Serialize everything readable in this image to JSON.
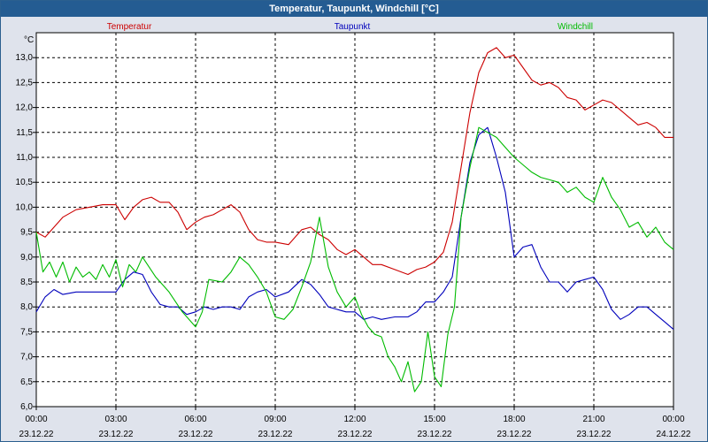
{
  "window": {
    "title": "Temperatur, Taupunkt, Windchill [°C]"
  },
  "colors": {
    "temperature": "#cc0000",
    "dewpoint": "#0000bb",
    "windchill": "#00bb00",
    "grid": "#000000",
    "frame": "#245c92"
  },
  "chart_data": {
    "type": "line",
    "title": "Temperatur, Taupunkt, Windchill [°C]",
    "ylabel": "°C",
    "xlabel": "",
    "ylim": [
      6.0,
      13.5
    ],
    "xlim": [
      "2022-12-23 00:00",
      "2022-12-24 00:00"
    ],
    "grid": true,
    "legend_placement": "top",
    "y_ticks": [
      "6,0",
      "6,5",
      "7,0",
      "7,5",
      "8,0",
      "8,5",
      "9,0",
      "9,5",
      "10,0",
      "10,5",
      "11,0",
      "11,5",
      "12,0",
      "12,5",
      "13,0"
    ],
    "x_ticks": [
      {
        "time": "00:00",
        "date": "23.12.22"
      },
      {
        "time": "03:00",
        "date": "23.12.22"
      },
      {
        "time": "06:00",
        "date": "23.12.22"
      },
      {
        "time": "09:00",
        "date": "23.12.22"
      },
      {
        "time": "12:00",
        "date": "23.12.22"
      },
      {
        "time": "15:00",
        "date": "23.12.22"
      },
      {
        "time": "18:00",
        "date": "23.12.22"
      },
      {
        "time": "21:00",
        "date": "23.12.22"
      },
      {
        "time": "00:00",
        "date": "24.12.22"
      }
    ],
    "series": [
      {
        "name": "Temperatur",
        "color": "#cc0000",
        "time": [
          "2022-12-23 00:00",
          "2022-12-23 00:20",
          "2022-12-23 00:40",
          "2022-12-23 01:00",
          "2022-12-23 01:30",
          "2022-12-23 02:00",
          "2022-12-23 02:30",
          "2022-12-23 03:00",
          "2022-12-23 03:20",
          "2022-12-23 03:40",
          "2022-12-23 04:00",
          "2022-12-23 04:20",
          "2022-12-23 04:40",
          "2022-12-23 05:00",
          "2022-12-23 05:20",
          "2022-12-23 05:40",
          "2022-12-23 06:00",
          "2022-12-23 06:20",
          "2022-12-23 06:40",
          "2022-12-23 07:00",
          "2022-12-23 07:20",
          "2022-12-23 07:40",
          "2022-12-23 08:00",
          "2022-12-23 08:20",
          "2022-12-23 08:40",
          "2022-12-23 09:00",
          "2022-12-23 09:30",
          "2022-12-23 10:00",
          "2022-12-23 10:20",
          "2022-12-23 10:40",
          "2022-12-23 11:00",
          "2022-12-23 11:20",
          "2022-12-23 11:40",
          "2022-12-23 12:00",
          "2022-12-23 12:20",
          "2022-12-23 12:40",
          "2022-12-23 13:00",
          "2022-12-23 13:30",
          "2022-12-23 14:00",
          "2022-12-23 14:20",
          "2022-12-23 14:40",
          "2022-12-23 15:00",
          "2022-12-23 15:20",
          "2022-12-23 15:40",
          "2022-12-23 16:00",
          "2022-12-23 16:20",
          "2022-12-23 16:40",
          "2022-12-23 17:00",
          "2022-12-23 17:20",
          "2022-12-23 17:40",
          "2022-12-23 18:00",
          "2022-12-23 18:20",
          "2022-12-23 18:40",
          "2022-12-23 19:00",
          "2022-12-23 19:20",
          "2022-12-23 19:40",
          "2022-12-23 20:00",
          "2022-12-23 20:20",
          "2022-12-23 20:40",
          "2022-12-23 21:00",
          "2022-12-23 21:20",
          "2022-12-23 21:40",
          "2022-12-23 22:00",
          "2022-12-23 22:20",
          "2022-12-23 22:40",
          "2022-12-23 23:00",
          "2022-12-23 23:20",
          "2022-12-23 23:40",
          "2022-12-24 00:00"
        ],
        "values": [
          9.5,
          9.4,
          9.6,
          9.8,
          9.95,
          10.0,
          10.05,
          10.05,
          9.75,
          10.0,
          10.15,
          10.2,
          10.1,
          10.1,
          9.9,
          9.55,
          9.7,
          9.8,
          9.85,
          9.95,
          10.05,
          9.9,
          9.55,
          9.35,
          9.3,
          9.3,
          9.25,
          9.55,
          9.6,
          9.45,
          9.35,
          9.15,
          9.05,
          9.15,
          9.0,
          8.85,
          8.85,
          8.75,
          8.65,
          8.75,
          8.8,
          8.9,
          9.1,
          9.7,
          10.8,
          11.9,
          12.7,
          13.1,
          13.2,
          13.0,
          13.05,
          12.8,
          12.55,
          12.45,
          12.5,
          12.4,
          12.2,
          12.15,
          11.95,
          12.05,
          12.15,
          12.1,
          11.95,
          11.8,
          11.65,
          11.7,
          11.6,
          11.4,
          11.4
        ]
      },
      {
        "name": "Taupunkt",
        "color": "#0000bb",
        "time": [
          "2022-12-23 00:00",
          "2022-12-23 00:20",
          "2022-12-23 00:40",
          "2022-12-23 01:00",
          "2022-12-23 01:30",
          "2022-12-23 02:00",
          "2022-12-23 02:30",
          "2022-12-23 03:00",
          "2022-12-23 03:20",
          "2022-12-23 03:40",
          "2022-12-23 04:00",
          "2022-12-23 04:20",
          "2022-12-23 04:40",
          "2022-12-23 05:00",
          "2022-12-23 05:20",
          "2022-12-23 05:40",
          "2022-12-23 06:00",
          "2022-12-23 06:20",
          "2022-12-23 06:40",
          "2022-12-23 07:00",
          "2022-12-23 07:20",
          "2022-12-23 07:40",
          "2022-12-23 08:00",
          "2022-12-23 08:20",
          "2022-12-23 08:40",
          "2022-12-23 09:00",
          "2022-12-23 09:30",
          "2022-12-23 10:00",
          "2022-12-23 10:20",
          "2022-12-23 10:40",
          "2022-12-23 11:00",
          "2022-12-23 11:20",
          "2022-12-23 11:40",
          "2022-12-23 12:00",
          "2022-12-23 12:20",
          "2022-12-23 12:40",
          "2022-12-23 13:00",
          "2022-12-23 13:30",
          "2022-12-23 14:00",
          "2022-12-23 14:20",
          "2022-12-23 14:40",
          "2022-12-23 15:00",
          "2022-12-23 15:20",
          "2022-12-23 15:40",
          "2022-12-23 16:00",
          "2022-12-23 16:20",
          "2022-12-23 16:40",
          "2022-12-23 17:00",
          "2022-12-23 17:20",
          "2022-12-23 17:40",
          "2022-12-23 18:00",
          "2022-12-23 18:20",
          "2022-12-23 18:40",
          "2022-12-23 19:00",
          "2022-12-23 19:20",
          "2022-12-23 19:40",
          "2022-12-23 20:00",
          "2022-12-23 20:20",
          "2022-12-23 20:40",
          "2022-12-23 21:00",
          "2022-12-23 21:20",
          "2022-12-23 21:40",
          "2022-12-23 22:00",
          "2022-12-23 22:20",
          "2022-12-23 22:40",
          "2022-12-23 23:00",
          "2022-12-23 23:20",
          "2022-12-23 23:40",
          "2022-12-24 00:00"
        ],
        "values": [
          7.9,
          8.2,
          8.35,
          8.25,
          8.3,
          8.3,
          8.3,
          8.3,
          8.55,
          8.7,
          8.65,
          8.3,
          8.05,
          8.0,
          8.0,
          7.85,
          7.9,
          8.0,
          7.95,
          8.0,
          8.0,
          7.95,
          8.2,
          8.3,
          8.35,
          8.2,
          8.3,
          8.55,
          8.45,
          8.25,
          8.0,
          7.95,
          7.9,
          7.9,
          7.75,
          7.8,
          7.75,
          7.8,
          7.8,
          7.9,
          8.1,
          8.1,
          8.3,
          8.6,
          9.8,
          10.9,
          11.45,
          11.6,
          11.0,
          10.3,
          9.0,
          9.2,
          9.25,
          8.8,
          8.5,
          8.5,
          8.3,
          8.5,
          8.55,
          8.6,
          8.35,
          7.95,
          7.75,
          7.85,
          8.0,
          8.0,
          7.85,
          7.7,
          7.55
        ]
      },
      {
        "name": "Windchill",
        "color": "#00bb00",
        "time": [
          "2022-12-23 00:00",
          "2022-12-23 00:15",
          "2022-12-23 00:30",
          "2022-12-23 00:45",
          "2022-12-23 01:00",
          "2022-12-23 01:15",
          "2022-12-23 01:30",
          "2022-12-23 01:45",
          "2022-12-23 02:00",
          "2022-12-23 02:15",
          "2022-12-23 02:30",
          "2022-12-23 02:45",
          "2022-12-23 03:00",
          "2022-12-23 03:15",
          "2022-12-23 03:30",
          "2022-12-23 03:45",
          "2022-12-23 04:00",
          "2022-12-23 04:30",
          "2022-12-23 05:00",
          "2022-12-23 05:30",
          "2022-12-23 06:00",
          "2022-12-23 06:15",
          "2022-12-23 06:30",
          "2022-12-23 07:00",
          "2022-12-23 07:20",
          "2022-12-23 07:40",
          "2022-12-23 08:00",
          "2022-12-23 08:20",
          "2022-12-23 08:40",
          "2022-12-23 09:00",
          "2022-12-23 09:20",
          "2022-12-23 09:40",
          "2022-12-23 10:00",
          "2022-12-23 10:20",
          "2022-12-23 10:40",
          "2022-12-23 11:00",
          "2022-12-23 11:20",
          "2022-12-23 11:40",
          "2022-12-23 12:00",
          "2022-12-23 12:15",
          "2022-12-23 12:30",
          "2022-12-23 12:45",
          "2022-12-23 13:00",
          "2022-12-23 13:15",
          "2022-12-23 13:30",
          "2022-12-23 13:45",
          "2022-12-23 14:00",
          "2022-12-23 14:15",
          "2022-12-23 14:30",
          "2022-12-23 14:45",
          "2022-12-23 15:00",
          "2022-12-23 15:15",
          "2022-12-23 15:30",
          "2022-12-23 15:45",
          "2022-12-23 16:00",
          "2022-12-23 16:20",
          "2022-12-23 16:40",
          "2022-12-23 17:00",
          "2022-12-23 17:20",
          "2022-12-23 17:40",
          "2022-12-23 18:00",
          "2022-12-23 18:20",
          "2022-12-23 18:40",
          "2022-12-23 19:00",
          "2022-12-23 19:20",
          "2022-12-23 19:40",
          "2022-12-23 20:00",
          "2022-12-23 20:20",
          "2022-12-23 20:40",
          "2022-12-23 21:00",
          "2022-12-23 21:20",
          "2022-12-23 21:40",
          "2022-12-23 22:00",
          "2022-12-23 22:20",
          "2022-12-23 22:40",
          "2022-12-23 23:00",
          "2022-12-23 23:20",
          "2022-12-23 23:40",
          "2022-12-24 00:00"
        ],
        "values": [
          9.5,
          8.7,
          8.9,
          8.6,
          8.9,
          8.5,
          8.8,
          8.6,
          8.7,
          8.55,
          8.85,
          8.6,
          8.95,
          8.4,
          8.85,
          8.7,
          9.0,
          8.6,
          8.3,
          7.9,
          7.6,
          7.9,
          8.55,
          8.5,
          8.7,
          9.0,
          8.85,
          8.6,
          8.3,
          7.8,
          7.75,
          7.95,
          8.4,
          8.9,
          9.8,
          8.8,
          8.3,
          8.0,
          8.2,
          7.85,
          7.6,
          7.45,
          7.4,
          7.0,
          6.8,
          6.5,
          6.9,
          6.3,
          6.5,
          7.5,
          6.6,
          6.4,
          7.45,
          8.0,
          9.8,
          10.8,
          11.6,
          11.5,
          11.4,
          11.2,
          11.0,
          10.85,
          10.7,
          10.6,
          10.55,
          10.5,
          10.3,
          10.4,
          10.2,
          10.1,
          10.6,
          10.2,
          9.95,
          9.6,
          9.7,
          9.4,
          9.6,
          9.3,
          9.15
        ]
      }
    ]
  }
}
